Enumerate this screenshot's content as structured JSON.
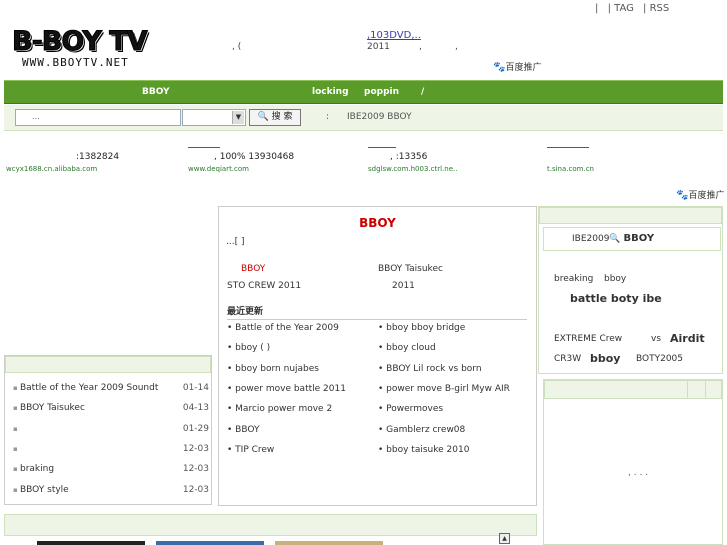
{
  "header": {
    "top_links": [
      "|",
      "| TAG",
      "| RSS"
    ],
    "logo_text": "B-BOY TV",
    "logo_url_text": "WWW.BBOYTV.NET",
    "mid_text_1": ",  (",
    "dvd_link": ",103DVD,..",
    "year_text": "2011",
    "comma_1": ",",
    "comma_2": ",",
    "baidu_label": "百度推广",
    "baidu_icon": "paw-icon"
  },
  "nav": {
    "items": [
      "BBOY",
      "locking",
      "poppin",
      "/"
    ]
  },
  "search": {
    "placeholder": "...",
    "button_label": "搜 索",
    "colon": ":",
    "hot_text": "IBE2009  BBOY"
  },
  "ads": [
    {
      "title": ":1382824",
      "url": "wcyx1688.cn.alibaba.com"
    },
    {
      "title": ",  100%     13930468",
      "url": "www.deqiart.com"
    },
    {
      "title": ",          :13356",
      "url": "sdglsw.com.h003.ctrl.ne.."
    },
    {
      "title": "",
      "url": "t.sina.com.cn"
    }
  ],
  "baidu2": "百度推广",
  "center": {
    "title": "BBOY",
    "more": "...[  ]",
    "feature_left": "BBOY",
    "feature_right": "BBOY Taisukec",
    "sub_left": "STO CREW 2011",
    "sub_right": "2011",
    "section_title": "最近更新",
    "updates_left": [
      "• Battle of the Year 2009",
      "• bboy     (  )",
      "• bboy born nujabes",
      "• power move battle 2011",
      "• Marcio power move        2",
      "• BBOY",
      "•          TIP Crew"
    ],
    "updates_right": [
      "•      bboy     bboy bridge",
      "• bboy cloud",
      "• BBOY Lil rock vs born",
      "• power move B-girl Myw AIR",
      "•        Powermoves",
      "•          Gamblerz crew08",
      "• bboy taisuke 2010"
    ]
  },
  "right1": {
    "title": "IBE2009",
    "title_bold": "BBOY",
    "line1a": "breaking",
    "line1b": "bboy",
    "line2": "battle  boty  ibe",
    "line3a": "EXTREME Crew",
    "line3b": "vs",
    "line3c": "Airdit",
    "line4a": "CR3W",
    "line4b": "bboy",
    "line4c": "BOTY2005"
  },
  "right2": {
    "text": ",  . . ."
  },
  "left_list": [
    {
      "title": "Battle of the Year 2009 Soundt",
      "date": "01-14"
    },
    {
      "title": "BBOY Taisukec",
      "date": "04-13"
    },
    {
      "title": "",
      "date": "01-29"
    },
    {
      "title": "",
      "date": "12-03"
    },
    {
      "title": "braking",
      "date": "12-03"
    },
    {
      "title": "BBOY style",
      "date": "12-03"
    }
  ],
  "colors": {
    "nav_green": "#5a9b2a",
    "panel_bg": "#eef5e6",
    "accent_red": "#cc0000",
    "link_green": "#2b7a2b"
  }
}
